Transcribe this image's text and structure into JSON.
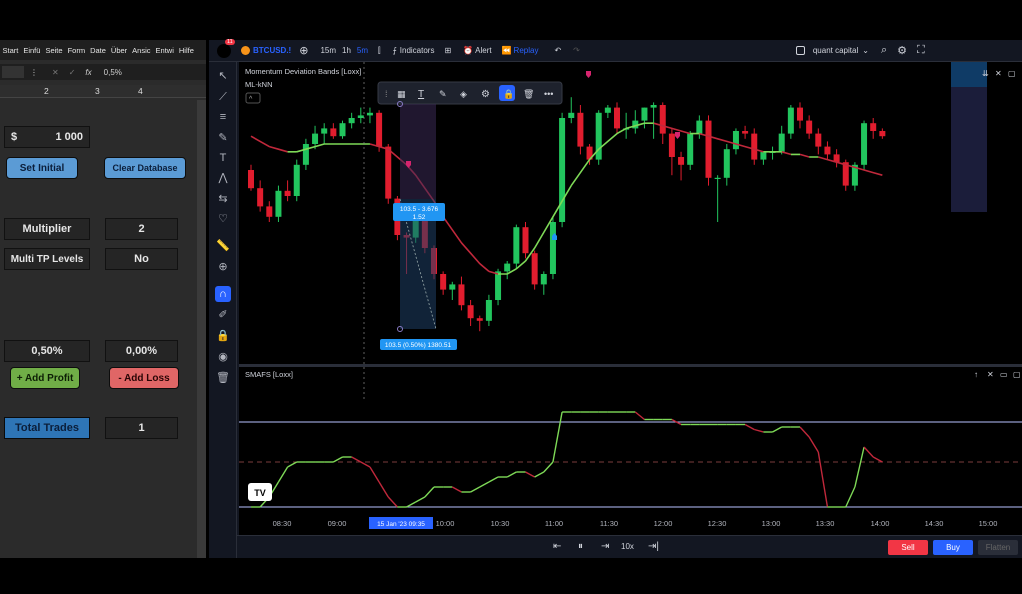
{
  "spreadsheet": {
    "menu": [
      "Start",
      "Einfü",
      "Seite",
      "Form",
      "Date",
      "Über",
      "Ansic",
      "Entwi",
      "Hilfe"
    ],
    "formula_value": "0,5%",
    "fx_label": "fx",
    "columns": [
      "2",
      "3",
      "4"
    ],
    "currency_symbol": "$",
    "capital": "1 000",
    "set_initial": "Set Initial",
    "clear_database": "Clear Database",
    "multiplier_label": "Multiplier",
    "multiplier_value": "2",
    "multi_tp_label": "Multi TP Levels",
    "multi_tp_value": "No",
    "profit_pct": "0,50%",
    "loss_pct": "0,00%",
    "add_profit": "+ Add Profit",
    "add_loss": "- Add Loss",
    "total_trades_label": "Total Trades",
    "total_trades_value": "1",
    "colors": {
      "set_initial": "#5b9bd5",
      "add_profit": "#70ad47",
      "add_loss": "#e06666",
      "total_trades": "#2e75b6"
    }
  },
  "tradingview": {
    "notification_count": "11",
    "symbol": "BTCUSD.!",
    "intervals": [
      "15m",
      "1h",
      "5m"
    ],
    "active_interval": "5m",
    "indicators_label": "Indicators",
    "alert_label": "Alert",
    "replay_label": "Replay",
    "account_name": "quant capital",
    "main_indicator": "Momentum Deviation Bands [Loxx]",
    "main_indicator_2": "ML-kNN",
    "lower_indicator": "SMAFS [Loxx]",
    "position_label_top": "103.5 - 3.676",
    "position_label_ratio": "1.52",
    "position_label_bottom": "103.5 (0.50%) 1380.51",
    "time_labels": [
      "08:30",
      "09:00",
      "10:00",
      "10:30",
      "11:00",
      "11:30",
      "12:00",
      "12:30",
      "13:00",
      "13:30",
      "14:00",
      "14:30",
      "15:00"
    ],
    "cursor_time": "15 Jan '23  09:35",
    "replay_speed": "10x",
    "sell_label": "Sell",
    "buy_label": "Buy",
    "flatten_label": "Flatten",
    "logo_text": "TV",
    "colors": {
      "up": "#22c55e",
      "down": "#e11d2e",
      "accent": "#2962ff",
      "sell": "#f23645",
      "buy": "#2962ff",
      "ma_red": "#c0283b",
      "ma_green": "#7ed957"
    }
  },
  "chart_data": {
    "type": "candlestick",
    "x": [
      "08:10",
      "08:15",
      "08:20",
      "08:25",
      "08:30",
      "08:35",
      "08:40",
      "08:45",
      "08:50",
      "08:55",
      "09:00",
      "09:05",
      "09:10",
      "09:15",
      "09:20",
      "09:25",
      "09:30",
      "09:35",
      "09:40",
      "09:45",
      "09:50",
      "09:55",
      "10:00",
      "10:05",
      "10:10",
      "10:15",
      "10:20",
      "10:25",
      "10:30",
      "10:35",
      "10:40",
      "10:45",
      "10:50",
      "10:55",
      "11:00",
      "11:05",
      "11:10",
      "11:15",
      "11:20",
      "11:25",
      "11:30",
      "11:35",
      "11:40",
      "11:45",
      "11:50",
      "11:55",
      "12:00",
      "12:05",
      "12:10",
      "12:15",
      "12:20",
      "12:25",
      "12:30",
      "12:35",
      "12:40",
      "12:45",
      "12:50",
      "12:55",
      "13:00",
      "13:05",
      "13:10",
      "13:15",
      "13:20",
      "13:25",
      "13:30",
      "13:35",
      "13:40",
      "13:45",
      "13:50",
      "13:55"
    ],
    "series": [
      {
        "name": "open",
        "values": [
          70,
          63,
          56,
          52,
          62,
          60,
          72,
          80,
          84,
          86,
          83,
          88,
          90,
          91,
          92,
          79,
          59,
          45,
          44,
          54,
          40,
          30,
          24,
          26,
          18,
          13,
          12,
          20,
          31,
          34,
          48,
          38,
          26,
          30,
          50,
          90,
          92,
          79,
          74,
          92,
          94,
          86,
          86,
          89,
          94,
          95,
          84,
          75,
          72,
          84,
          89,
          67,
          67,
          78,
          85,
          84,
          74,
          77,
          77,
          84,
          94,
          89,
          84,
          79,
          76,
          73,
          64,
          72,
          88,
          85
        ]
      },
      {
        "name": "high",
        "values": [
          72,
          66,
          58,
          64,
          66,
          74,
          82,
          87,
          88,
          88,
          89,
          92,
          94,
          94,
          93,
          80,
          60,
          46,
          57,
          56,
          41,
          31,
          27,
          29,
          20,
          14,
          22,
          32,
          35,
          49,
          50,
          39,
          31,
          52,
          92,
          98,
          95,
          80,
          93,
          95,
          96,
          92,
          93,
          94,
          96,
          96,
          86,
          77,
          85,
          91,
          91,
          68,
          80,
          86,
          87,
          86,
          77,
          79,
          87,
          95,
          96,
          91,
          86,
          81,
          78,
          74,
          73,
          89,
          90,
          86
        ]
      },
      {
        "name": "low",
        "values": [
          62,
          54,
          50,
          50,
          58,
          58,
          70,
          78,
          80,
          82,
          82,
          86,
          88,
          88,
          77,
          57,
          43,
          30,
          42,
          38,
          28,
          22,
          20,
          16,
          10,
          8,
          10,
          18,
          28,
          32,
          36,
          24,
          22,
          28,
          48,
          88,
          76,
          72,
          72,
          90,
          84,
          82,
          84,
          86,
          82,
          80,
          68,
          66,
          70,
          82,
          64,
          50,
          64,
          76,
          82,
          72,
          72,
          74,
          76,
          82,
          86,
          82,
          76,
          74,
          71,
          62,
          62,
          70,
          82,
          82
        ]
      },
      {
        "name": "close",
        "values": [
          63,
          56,
          52,
          62,
          60,
          72,
          80,
          84,
          86,
          83,
          88,
          90,
          91,
          92,
          79,
          59,
          45,
          44,
          54,
          40,
          30,
          24,
          26,
          18,
          13,
          12,
          20,
          31,
          34,
          48,
          38,
          26,
          30,
          50,
          90,
          92,
          79,
          74,
          92,
          94,
          86,
          86,
          89,
          94,
          95,
          84,
          75,
          72,
          84,
          89,
          67,
          67,
          78,
          85,
          84,
          74,
          77,
          77,
          84,
          94,
          89,
          84,
          79,
          76,
          73,
          64,
          72,
          88,
          85,
          83
        ]
      }
    ],
    "moving_average": [
      83,
      81,
      79,
      78,
      77,
      77,
      78,
      79,
      80,
      80,
      80,
      80,
      80,
      80,
      79,
      78,
      75,
      72,
      68,
      63,
      58,
      52,
      47,
      42,
      38,
      34,
      31,
      30,
      30,
      32,
      35,
      40,
      46,
      52,
      58,
      64,
      69,
      74,
      78,
      81,
      84,
      86,
      87,
      88,
      88,
      87,
      86,
      85,
      84,
      84,
      83,
      82,
      81,
      80,
      79,
      78,
      77,
      77,
      77,
      76,
      76,
      75,
      75,
      74,
      73,
      72,
      71,
      70,
      69,
      68
    ],
    "ma_trend": "down-up-down",
    "oscillator": {
      "name": "SMAFS [Loxx]",
      "values": [
        -0.9,
        -0.9,
        -0.7,
        -0.4,
        -0.1,
        0.0,
        0.0,
        0.0,
        0.0,
        0.0,
        0.1,
        0.1,
        0.0,
        -0.1,
        -0.4,
        -0.7,
        -0.9,
        -0.9,
        -0.8,
        -0.7,
        -0.5,
        -0.5,
        -0.5,
        -0.6,
        -0.6,
        -0.5,
        -0.4,
        -0.3,
        -0.3,
        -0.2,
        -0.2,
        -0.3,
        -0.2,
        0.0,
        1.0,
        1.0,
        1.0,
        1.0,
        1.0,
        1.0,
        1.0,
        1.0,
        1.0,
        0.85,
        0.85,
        0.85,
        0.85,
        0.75,
        0.75,
        0.75,
        0.75,
        0.75,
        0.75,
        0.75,
        0.75,
        0.65,
        0.6,
        0.6,
        0.7,
        0.7,
        0.7,
        0.5,
        0.2,
        -0.9,
        -0.9,
        -0.9,
        -0.5,
        0.3,
        0.1,
        0.0
      ],
      "upper": 0.8,
      "mid": 0.0,
      "lower": -0.9
    }
  }
}
